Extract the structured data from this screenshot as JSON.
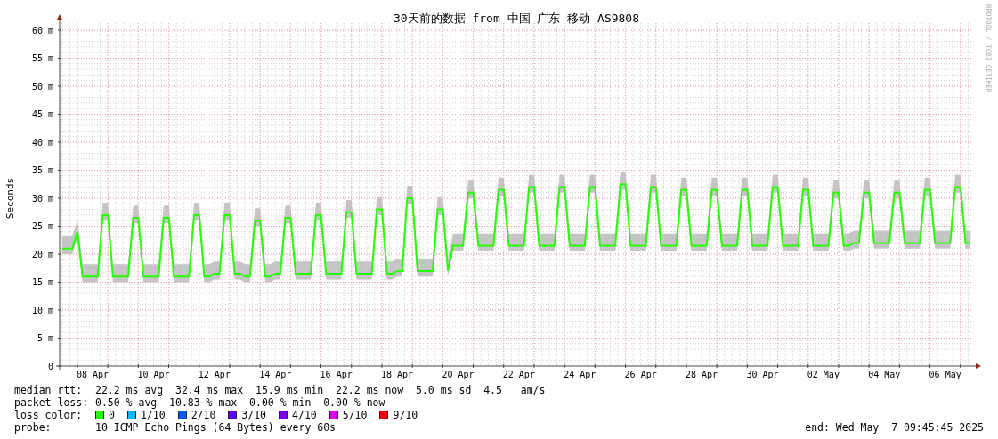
{
  "graph": {
    "signature": "RRDTOOL / TOBI OETIKER",
    "chart_data": {
      "type": "line",
      "title": "30天前的数据 from 中国 广东 移动 AS9808",
      "ylabel": "Seconds",
      "ylim": [
        0,
        60
      ],
      "grid": true,
      "categories": [
        null,
        null,
        null,
        null,
        null,
        null,
        "08 Apr",
        null,
        null,
        null,
        null,
        null,
        null,
        null,
        null,
        null,
        null,
        null,
        "10 Apr",
        null,
        null,
        null,
        null,
        null,
        null,
        null,
        null,
        null,
        null,
        null,
        "12 Apr",
        null,
        null,
        null,
        null,
        null,
        null,
        null,
        null,
        null,
        null,
        null,
        "14 Apr",
        null,
        null,
        null,
        null,
        null,
        null,
        null,
        null,
        null,
        null,
        null,
        "16 Apr",
        null,
        null,
        null,
        null,
        null,
        null,
        null,
        null,
        null,
        null,
        null,
        "18 Apr",
        null,
        null,
        null,
        null,
        null,
        null,
        null,
        null,
        null,
        null,
        null,
        "20 Apr",
        null,
        null,
        null,
        null,
        null,
        null,
        null,
        null,
        null,
        null,
        null,
        "22 Apr",
        null,
        null,
        null,
        null,
        null,
        null,
        null,
        null,
        null,
        null,
        null,
        "24 Apr",
        null,
        null,
        null,
        null,
        null,
        null,
        null,
        null,
        null,
        null,
        null,
        "26 Apr",
        null,
        null,
        null,
        null,
        null,
        null,
        null,
        null,
        null,
        null,
        null,
        "28 Apr",
        null,
        null,
        null,
        null,
        null,
        null,
        null,
        null,
        null,
        null,
        null,
        "30 Apr",
        null,
        null,
        null,
        null,
        null,
        null,
        null,
        null,
        null,
        null,
        null,
        "02 May",
        null,
        null,
        null,
        null,
        null,
        null,
        null,
        null,
        null,
        null,
        null,
        "04 May",
        null,
        null,
        null,
        null,
        null,
        null,
        null,
        null,
        null,
        null,
        null,
        "06 May",
        null,
        null,
        null,
        null,
        null
      ],
      "series": [
        {
          "color": "#26ff00",
          "values": [
            21,
            21,
            21,
            24,
            16,
            16,
            16,
            16,
            27,
            27,
            16,
            16,
            16,
            16,
            26.5,
            26.5,
            16,
            16,
            16,
            16,
            26.5,
            26.5,
            16,
            16,
            16,
            16,
            27,
            27,
            16,
            16,
            16.5,
            16.5,
            27,
            27,
            16.5,
            16.5,
            16,
            16,
            26,
            26,
            16,
            16,
            16.5,
            16.5,
            26.5,
            26.5,
            16.5,
            16.5,
            16.5,
            16.5,
            27,
            27,
            16.5,
            16.5,
            16.5,
            16.5,
            27.5,
            27.5,
            16.5,
            16.5,
            16.5,
            16.5,
            28,
            28,
            16.5,
            16.5,
            17,
            17,
            30,
            30,
            17,
            17,
            17,
            17,
            28,
            28,
            17,
            21.5,
            21.5,
            21.5,
            31,
            31,
            21.5,
            21.5,
            21.5,
            21.5,
            31.5,
            31.5,
            21.5,
            21.5,
            21.5,
            21.5,
            32,
            32,
            21.5,
            21.5,
            21.5,
            21.5,
            32,
            32,
            21.5,
            21.5,
            21.5,
            21.5,
            32,
            32,
            21.5,
            21.5,
            21.5,
            21.5,
            32.5,
            32.5,
            21.5,
            21.5,
            21.5,
            21.5,
            32,
            32,
            21.5,
            21.5,
            21.5,
            21.5,
            31.5,
            31.5,
            21.5,
            21.5,
            21.5,
            21.5,
            31.5,
            31.5,
            21.5,
            21.5,
            21.5,
            21.5,
            31.5,
            31.5,
            21.5,
            21.5,
            21.5,
            21.5,
            32,
            32,
            21.5,
            21.5,
            21.5,
            21.5,
            31.5,
            31.5,
            21.5,
            21.5,
            21.5,
            21.5,
            31,
            31,
            21.5,
            21.5,
            22,
            22,
            31,
            31,
            22,
            22,
            22,
            22,
            31,
            31,
            22,
            22,
            22,
            22,
            31.5,
            31.5,
            22,
            22,
            22,
            22,
            32,
            32,
            22,
            22
          ]
        }
      ],
      "yticks": [
        {
          "value": 0,
          "label": "0"
        },
        {
          "value": 5,
          "label": "5 m"
        },
        {
          "value": 10,
          "label": "10 m"
        },
        {
          "value": 15,
          "label": "15 m"
        },
        {
          "value": 20,
          "label": "20 m"
        },
        {
          "value": 25,
          "label": "25 m"
        },
        {
          "value": 30,
          "label": "30 m"
        },
        {
          "value": 35,
          "label": "35 m"
        },
        {
          "value": 40,
          "label": "40 m"
        },
        {
          "value": 45,
          "label": "45 m"
        },
        {
          "value": 50,
          "label": "50 m"
        },
        {
          "value": 55,
          "label": "55 m"
        },
        {
          "value": 60,
          "label": "60 m"
        }
      ]
    }
  },
  "legend": {
    "median_rtt": {
      "label": "median rtt:",
      "value": "22.2 ms avg  32.4 ms max  15.9 ms min  22.2 ms now  5.0 ms sd  4.5   am/s"
    },
    "packet_loss": {
      "label": "packet loss:",
      "value": "0.50 % avg  10.83 % max  0.00 % min  0.00 % now"
    },
    "loss_color": {
      "label": "loss color:",
      "items": [
        {
          "label": "0",
          "color": "#26ff00"
        },
        {
          "label": "1/10",
          "color": "#00b8ff"
        },
        {
          "label": "2/10",
          "color": "#0059ff"
        },
        {
          "label": "3/10",
          "color": "#5e00ff"
        },
        {
          "label": "4/10",
          "color": "#7e00ff"
        },
        {
          "label": "5/10",
          "color": "#dd00ff"
        },
        {
          "label": "9/10",
          "color": "#ff0000"
        }
      ]
    },
    "probe": {
      "label": "probe:",
      "value": "10 ICMP Echo Pings (64 Bytes) every 60s"
    },
    "end": "end: Wed May  7 09:45:45 2025"
  }
}
